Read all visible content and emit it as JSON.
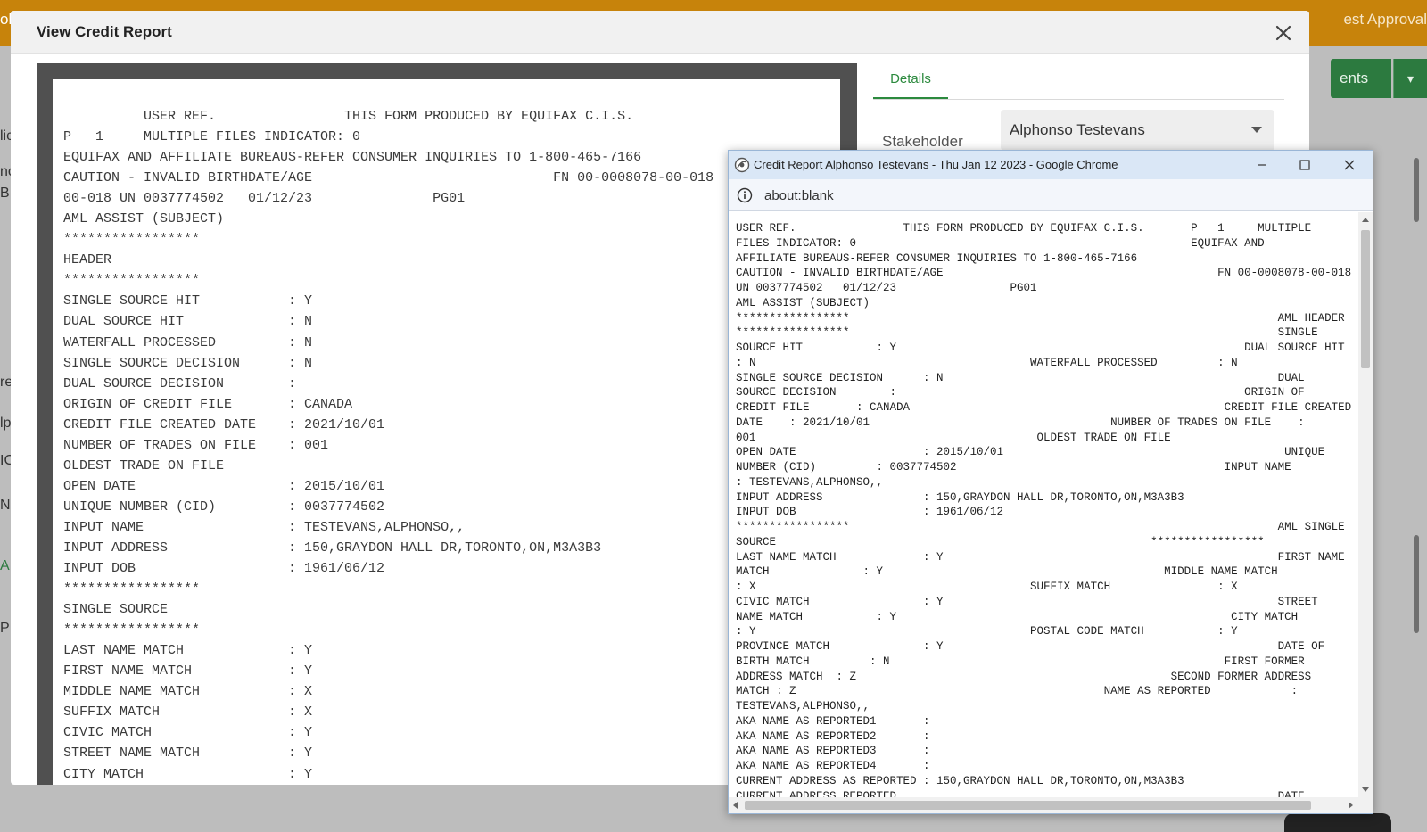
{
  "background": {
    "topbar_left_text": "oli",
    "topbar_right_text": "est Approval",
    "left_letters": [
      "lic",
      "nc",
      "B",
      "re",
      "lp",
      "IC",
      "N",
      "A",
      "P"
    ],
    "green_button_label": "ents",
    "green_button_caret": "▾"
  },
  "modal": {
    "title": "View Credit Report",
    "close_icon": "close-icon"
  },
  "report": {
    "lines": [
      "          USER REF.                THIS FORM PRODUCED BY EQUIFAX C.I.S.",
      "P   1     MULTIPLE FILES INDICATOR: 0",
      "EQUIFAX AND AFFILIATE BUREAUS-REFER CONSUMER INQUIRIES TO 1-800-465-7166",
      "CAUTION - INVALID BIRTHDATE/AGE                              FN 00-0008078-00-018",
      "00-018 UN 0037774502   01/12/23               PG01",
      "AML ASSIST (SUBJECT)",
      "*****************",
      "HEADER",
      "*****************",
      "SINGLE SOURCE HIT           : Y",
      "DUAL SOURCE HIT             : N",
      "WATERFALL PROCESSED         : N",
      "SINGLE SOURCE DECISION      : N",
      "DUAL SOURCE DECISION        :",
      "ORIGIN OF CREDIT FILE       : CANADA",
      "CREDIT FILE CREATED DATE    : 2021/10/01",
      "NUMBER OF TRADES ON FILE    : 001",
      "OLDEST TRADE ON FILE",
      "OPEN DATE                   : 2015/10/01",
      "UNIQUE NUMBER (CID)         : 0037774502",
      "INPUT NAME                  : TESTEVANS,ALPHONSO,,",
      "INPUT ADDRESS               : 150,GRAYDON HALL DR,TORONTO,ON,M3A3B3",
      "INPUT DOB                   : 1961/06/12",
      "*****************",
      "SINGLE SOURCE",
      "*****************",
      "LAST NAME MATCH             : Y",
      "FIRST NAME MATCH            : Y",
      "MIDDLE NAME MATCH           : X",
      "SUFFIX MATCH                : X",
      "CIVIC MATCH                 : Y",
      "STREET NAME MATCH           : Y",
      "CITY MATCH                  : Y"
    ]
  },
  "details": {
    "tab_label": "Details",
    "stakeholder_label": "Stakeholder",
    "stakeholder_value": "Alphonso Testevans"
  },
  "popup": {
    "window_title": "Credit Report Alphonso Testevans - Thu Jan 12 2023 - Google Chrome",
    "url": "about:blank",
    "lines": [
      "USER REF.                THIS FORM PRODUCED BY EQUIFAX C.I.S.       P   1     MULTIPLE",
      "FILES INDICATOR: 0                                                  EQUIFAX AND",
      "AFFILIATE BUREAUS-REFER CONSUMER INQUIRIES TO 1-800-465-7166",
      "CAUTION - INVALID BIRTHDATE/AGE                                         FN 00-0008078-00-018",
      "UN 0037774502   01/12/23                 PG01",
      "AML ASSIST (SUBJECT)",
      "*****************                                                                AML HEADER",
      "*****************                                                                SINGLE",
      "SOURCE HIT           : Y                                                    DUAL SOURCE HIT",
      ": N                                         WATERFALL PROCESSED         : N",
      "SINGLE SOURCE DECISION      : N                                                  DUAL",
      "SOURCE DECISION        :                                                    ORIGIN OF",
      "CREDIT FILE       : CANADA                                               CREDIT FILE CREATED",
      "DATE    : 2021/10/01                                    NUMBER OF TRADES ON FILE    :",
      "001                                          OLDEST TRADE ON FILE",
      "OPEN DATE                   : 2015/10/01                                          UNIQUE",
      "NUMBER (CID)         : 0037774502                                        INPUT NAME",
      ": TESTEVANS,ALPHONSO,,",
      "INPUT ADDRESS               : 150,GRAYDON HALL DR,TORONTO,ON,M3A3B3",
      "INPUT DOB                   : 1961/06/12",
      "*****************                                                                AML SINGLE",
      "SOURCE                                                        *****************",
      "LAST NAME MATCH             : Y                                                  FIRST NAME",
      "MATCH              : Y                                          MIDDLE NAME MATCH",
      ": X                                         SUFFIX MATCH                : X",
      "CIVIC MATCH                 : Y                                                  STREET",
      "NAME MATCH           : Y                                                  CITY MATCH",
      ": Y                                         POSTAL CODE MATCH           : Y",
      "PROVINCE MATCH              : Y                                                  DATE OF",
      "BIRTH MATCH         : N                                                  FIRST FORMER",
      "ADDRESS MATCH  : Z                                               SECOND FORMER ADDRESS",
      "MATCH : Z                                              NAME AS REPORTED            :",
      "TESTEVANS,ALPHONSO,,",
      "AKA NAME AS REPORTED1       :",
      "AKA NAME AS REPORTED2       :",
      "AKA NAME AS REPORTED3       :",
      "AKA NAME AS REPORTED4       :",
      "CURRENT ADDRESS AS REPORTED : 150,GRAYDON HALL DR,TORONTO,ON,M3A3B3",
      "CURRENT ADDRESS REPORTED                                                         DATE"
    ]
  },
  "colors": {
    "accent_green": "#2c8a3e",
    "topbar_orange": "#c7830b"
  }
}
